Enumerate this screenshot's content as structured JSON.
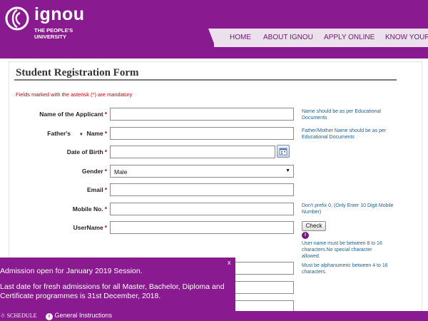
{
  "header": {
    "logo_name": "ignou",
    "logo_subtitle": "THE PEOPLE'S UNIVERSITY",
    "nav": [
      "HOME",
      "ABOUT IGNOU",
      "APPLY ONLINE",
      "KNOW YOUR"
    ]
  },
  "form": {
    "title": "Student  Registration Form",
    "mandatory_note": "Fields marked with the asterisk (*) are mandatory",
    "fields": [
      {
        "label": "Name of the Applicant",
        "required": "*",
        "hint": "Name should be as per Educational Documents"
      },
      {
        "label": "Father's",
        "relation_caret": "▼",
        "label_suffix": "Name",
        "required": "*",
        "hint": "Father/Mother Name should be as per Educational Documents"
      },
      {
        "label": "Date of Birth",
        "required": "*"
      },
      {
        "label": "Gender",
        "required": "*",
        "value": "Male"
      },
      {
        "label": "Email",
        "required": "*"
      },
      {
        "label": "Mobile No.",
        "required": "*",
        "hint": "Don't prefix 0, (Only Enter 10 Digit Mobile Number)"
      },
      {
        "label": "UserName",
        "required": "*",
        "button": "Check",
        "info": "i",
        "hint": "User name must be between 8 to 16 characters.No special character allowed."
      },
      {
        "hint": "Must be alphanumeric between 4 to 16 characters."
      }
    ]
  },
  "popup": {
    "close": "x",
    "line1": "Admission open for January 2019 Session.",
    "line2": "Last date for fresh admissions for all Master, Bachelor, Diploma and Certificate programmes is 31st December, 2018.",
    "schedule": "SCHEDULE",
    "general_instructions": "General Instructions"
  },
  "colors": {
    "brand": "#8a1a8f",
    "nav_bg": "#ece0ec",
    "required": "#c00000",
    "hint": "#1f5f8f"
  }
}
